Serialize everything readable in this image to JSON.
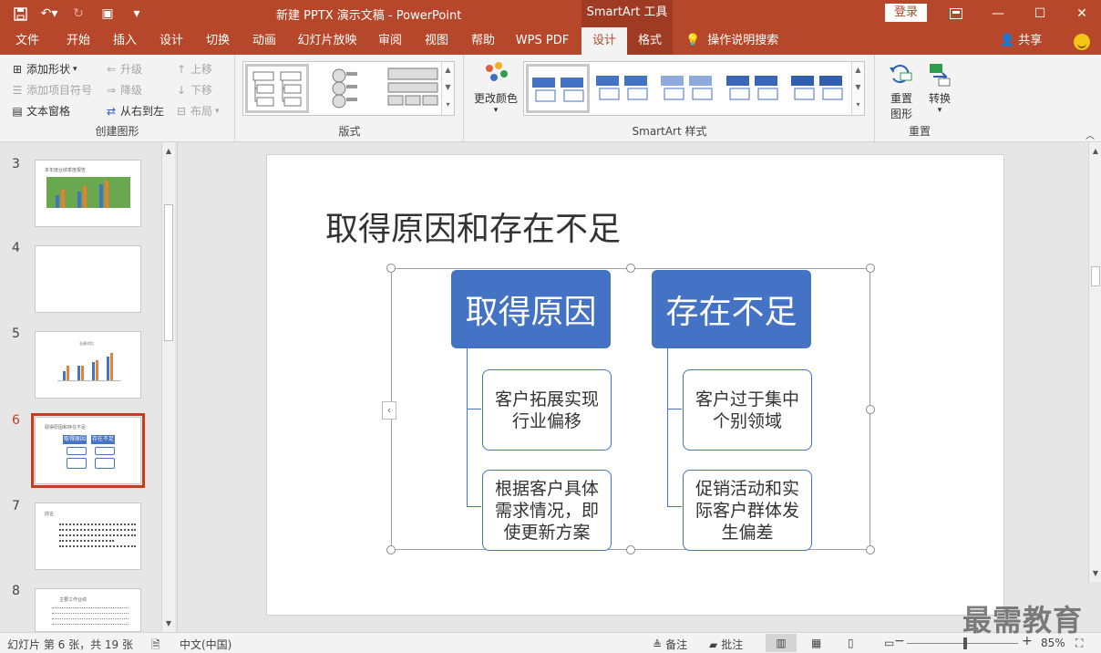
{
  "title_bar": {
    "doc_title": "新建 PPTX 演示文稿  -  PowerPoint",
    "context_tool": "SmartArt 工具",
    "login_label": "登录"
  },
  "tabs": [
    {
      "label": "文件"
    },
    {
      "label": "开始"
    },
    {
      "label": "插入"
    },
    {
      "label": "设计"
    },
    {
      "label": "切换"
    },
    {
      "label": "动画"
    },
    {
      "label": "幻灯片放映"
    },
    {
      "label": "审阅"
    },
    {
      "label": "视图"
    },
    {
      "label": "帮助"
    },
    {
      "label": "WPS PDF"
    },
    {
      "label": "设计"
    },
    {
      "label": "格式"
    },
    {
      "label": "操作说明搜索"
    }
  ],
  "share_label": "共享",
  "ribbon": {
    "create_graphic": {
      "label": "创建图形",
      "add_shape": "添加形状",
      "add_bullet": "添加项目符号",
      "text_pane": "文本窗格",
      "promote": "升级",
      "demote": "降级",
      "right_to_left": "从右到左",
      "move_up": "上移",
      "move_down": "下移",
      "layout": "布局"
    },
    "layouts": {
      "label": "版式"
    },
    "styles": {
      "label": "SmartArt 样式",
      "change_colors": "更改颜色"
    },
    "reset": {
      "label": "重置",
      "reset_graphic_line1": "重置",
      "reset_graphic_line2": "图形",
      "convert": "转换"
    }
  },
  "thumbnails": [
    {
      "num": "3",
      "title": "本年度业绩季度报告"
    },
    {
      "num": "4"
    },
    {
      "num": "5",
      "title": "业绩对比"
    },
    {
      "num": "6",
      "title": "取得原因和存在不足",
      "head1": "取得原因",
      "head2": "存在不足"
    },
    {
      "num": "7",
      "title": "前言"
    },
    {
      "num": "8",
      "title": "主要工作业绩"
    }
  ],
  "slide": {
    "title": "取得原因和存在不足",
    "smartart": {
      "left_head": "取得原因",
      "right_head": "存在不足",
      "left_children": [
        "客户拓展实现行业偏移",
        "根据客户具体需求情况，即使更新方案"
      ],
      "right_children": [
        "客户过于集中个别领域",
        "促销活动和实际客户群体发生偏差"
      ]
    }
  },
  "status": {
    "slide_count": "幻灯片 第 6 张，共 19 张",
    "language": "中文(中国)",
    "notes": "备注",
    "comments": "批注",
    "zoom": "85%"
  },
  "watermark": "最需教育",
  "colors": {
    "accent": "#b7472a",
    "smartart_blue": "#4472c4",
    "active_slide": "#c43e1c"
  }
}
